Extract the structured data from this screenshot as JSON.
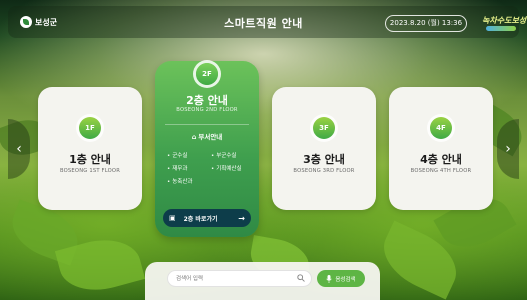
{
  "header": {
    "logo_text": "보성군",
    "title": "스마트직원 안내",
    "datetime": "2023.8.20 (월) 13:36",
    "brand_text": "녹차수도보성"
  },
  "nav": {
    "prev": "‹",
    "next": "›"
  },
  "floors": [
    {
      "badge": "1F",
      "title": "1층 안내",
      "subtitle": "BOSEONG 1ST FLOOR"
    },
    {
      "badge": "2F",
      "title": "2층 안내",
      "subtitle": "BOSEONG 2ND FLOOR",
      "active": true,
      "dept_heading": "부서안내",
      "departments": [
        "군수실",
        "부군수실",
        "재무과",
        "기획예산실",
        "농축산과"
      ],
      "goto_label": "2층 바로가기"
    },
    {
      "badge": "3F",
      "title": "3층 안내",
      "subtitle": "BOSEONG 3RD FLOOR"
    },
    {
      "badge": "4F",
      "title": "4층 안내",
      "subtitle": "BOSEONG 4TH FLOOR"
    }
  ],
  "search": {
    "placeholder": "검색어 입력",
    "voice_label": "음성검색"
  },
  "colors": {
    "accent_green": "#5eb545",
    "active_card": "#3f9f4e",
    "goto_button": "#0d3d4a"
  },
  "icons": {
    "dept": "building-icon",
    "goto": "map-icon",
    "search": "search-icon",
    "voice": "mic-icon"
  }
}
